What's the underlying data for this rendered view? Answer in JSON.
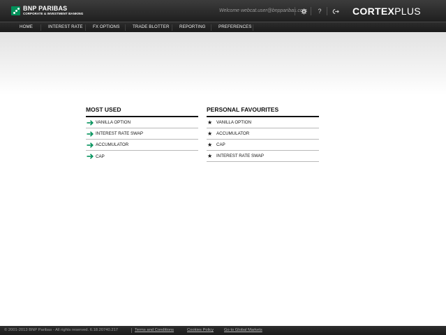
{
  "header": {
    "logo_name": "BNP PARIBAS",
    "logo_sub": "CORPORATE & INVESTMENT BANKING",
    "welcome": "Welcome webcat.user@bnpparibas.com",
    "settings_icon": "gear-icon",
    "help_label": "?",
    "logout_icon": "power-icon",
    "brand_bold": "CORTEX",
    "brand_light": "PLUS",
    "brand_color": "#00915a"
  },
  "nav": {
    "items": [
      "HOME",
      "INTEREST RATE",
      "FX OPTIONS",
      "TRADE BLOTTER",
      "REPORTING",
      "PREFERENCES"
    ]
  },
  "most_used": {
    "title": "MOST USED",
    "icon": "arrow-right-icon",
    "accent": "#00915a",
    "items": [
      "VANILLA OPTION",
      "INTEREST RATE SWAP",
      "ACCUMULATOR",
      "CAP"
    ]
  },
  "favourites": {
    "title": "PERSONAL FAVOURITES",
    "icon": "star-icon",
    "items": [
      "VANILLA OPTION",
      "ACCUMULATOR",
      "CAP",
      "INTEREST RATE SWAP"
    ]
  },
  "footer": {
    "copyright": "© 2001-2013 BNP Paribas - All rights reserved. 6.18.20740.217",
    "terms": "Terms and Conditions",
    "cookies": "Cookies Policy",
    "global": "Go to Global Markets"
  }
}
